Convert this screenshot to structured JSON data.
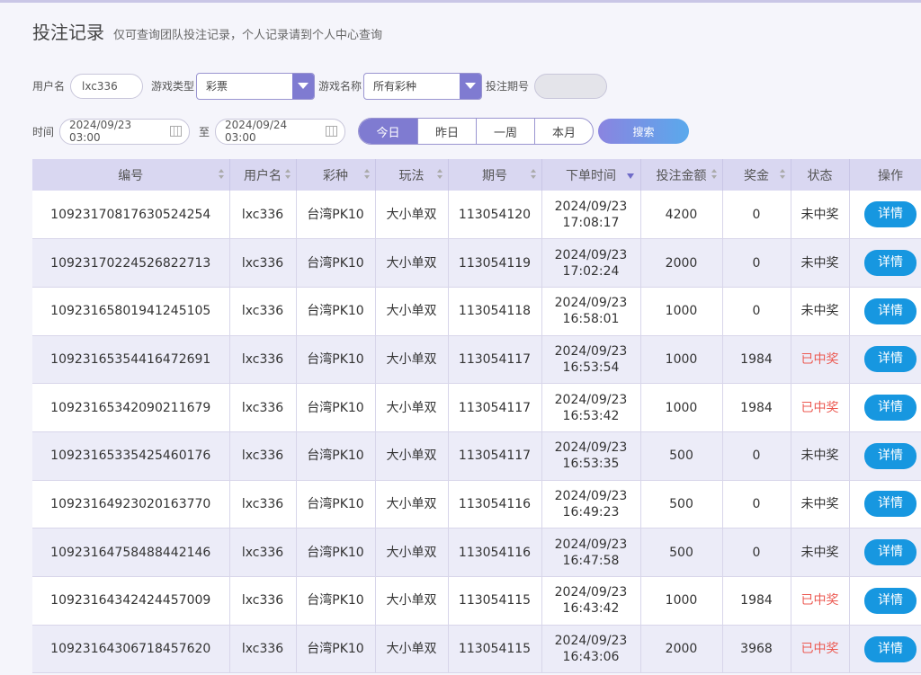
{
  "page": {
    "title": "投注记录",
    "subtitle": "仅可查询团队投注记录，个人记录请到个人中心查询"
  },
  "filters": {
    "username_label": "用户名",
    "username_value": "lxc336",
    "game_type_label": "游戏类型",
    "game_type_value": "彩票",
    "game_name_label": "游戏名称",
    "game_name_value": "所有彩种",
    "period_label": "投注期号",
    "period_value": "",
    "time_label": "时间",
    "start_time": "2024/09/23 03:00",
    "to_label": "至",
    "end_time": "2024/09/24 03:00",
    "quick_ranges": [
      "今日",
      "昨日",
      "一周",
      "本月"
    ],
    "active_range": "今日",
    "search_label": "搜索"
  },
  "table": {
    "headers": [
      "编号",
      "用户名",
      "彩种",
      "玩法",
      "期号",
      "下单时间",
      "投注金额",
      "奖金",
      "状态",
      "操作"
    ],
    "rows": [
      {
        "id": "10923170817630524254",
        "user": "lxc336",
        "lottery": "台湾PK10",
        "play": "大小单双",
        "period": "113054120",
        "date": "2024/09/23",
        "time": "17:08:17",
        "amount": "4200",
        "bonus": "0",
        "status": "未中奖",
        "won": false,
        "action": "详情"
      },
      {
        "id": "10923170224526822713",
        "user": "lxc336",
        "lottery": "台湾PK10",
        "play": "大小单双",
        "period": "113054119",
        "date": "2024/09/23",
        "time": "17:02:24",
        "amount": "2000",
        "bonus": "0",
        "status": "未中奖",
        "won": false,
        "action": "详情"
      },
      {
        "id": "10923165801941245105",
        "user": "lxc336",
        "lottery": "台湾PK10",
        "play": "大小单双",
        "period": "113054118",
        "date": "2024/09/23",
        "time": "16:58:01",
        "amount": "1000",
        "bonus": "0",
        "status": "未中奖",
        "won": false,
        "action": "详情"
      },
      {
        "id": "10923165354416472691",
        "user": "lxc336",
        "lottery": "台湾PK10",
        "play": "大小单双",
        "period": "113054117",
        "date": "2024/09/23",
        "time": "16:53:54",
        "amount": "1000",
        "bonus": "1984",
        "status": "已中奖",
        "won": true,
        "action": "详情"
      },
      {
        "id": "10923165342090211679",
        "user": "lxc336",
        "lottery": "台湾PK10",
        "play": "大小单双",
        "period": "113054117",
        "date": "2024/09/23",
        "time": "16:53:42",
        "amount": "1000",
        "bonus": "1984",
        "status": "已中奖",
        "won": true,
        "action": "详情"
      },
      {
        "id": "10923165335425460176",
        "user": "lxc336",
        "lottery": "台湾PK10",
        "play": "大小单双",
        "period": "113054117",
        "date": "2024/09/23",
        "time": "16:53:35",
        "amount": "500",
        "bonus": "0",
        "status": "未中奖",
        "won": false,
        "action": "详情"
      },
      {
        "id": "10923164923020163770",
        "user": "lxc336",
        "lottery": "台湾PK10",
        "play": "大小单双",
        "period": "113054116",
        "date": "2024/09/23",
        "time": "16:49:23",
        "amount": "500",
        "bonus": "0",
        "status": "未中奖",
        "won": false,
        "action": "详情"
      },
      {
        "id": "10923164758488442146",
        "user": "lxc336",
        "lottery": "台湾PK10",
        "play": "大小单双",
        "period": "113054116",
        "date": "2024/09/23",
        "time": "16:47:58",
        "amount": "500",
        "bonus": "0",
        "status": "未中奖",
        "won": false,
        "action": "详情"
      },
      {
        "id": "10923164342424457009",
        "user": "lxc336",
        "lottery": "台湾PK10",
        "play": "大小单双",
        "period": "113054115",
        "date": "2024/09/23",
        "time": "16:43:42",
        "amount": "1000",
        "bonus": "1984",
        "status": "已中奖",
        "won": true,
        "action": "详情"
      },
      {
        "id": "10923164306718457620",
        "user": "lxc336",
        "lottery": "台湾PK10",
        "play": "大小单双",
        "period": "113054115",
        "date": "2024/09/23",
        "time": "16:43:06",
        "amount": "2000",
        "bonus": "3968",
        "status": "已中奖",
        "won": true,
        "action": "详情"
      }
    ]
  },
  "colors": {
    "accent": "#7f7bd1",
    "win": "#ec5a52",
    "detail_button": "#1797e0",
    "header_bg": "#d9d7f1"
  }
}
